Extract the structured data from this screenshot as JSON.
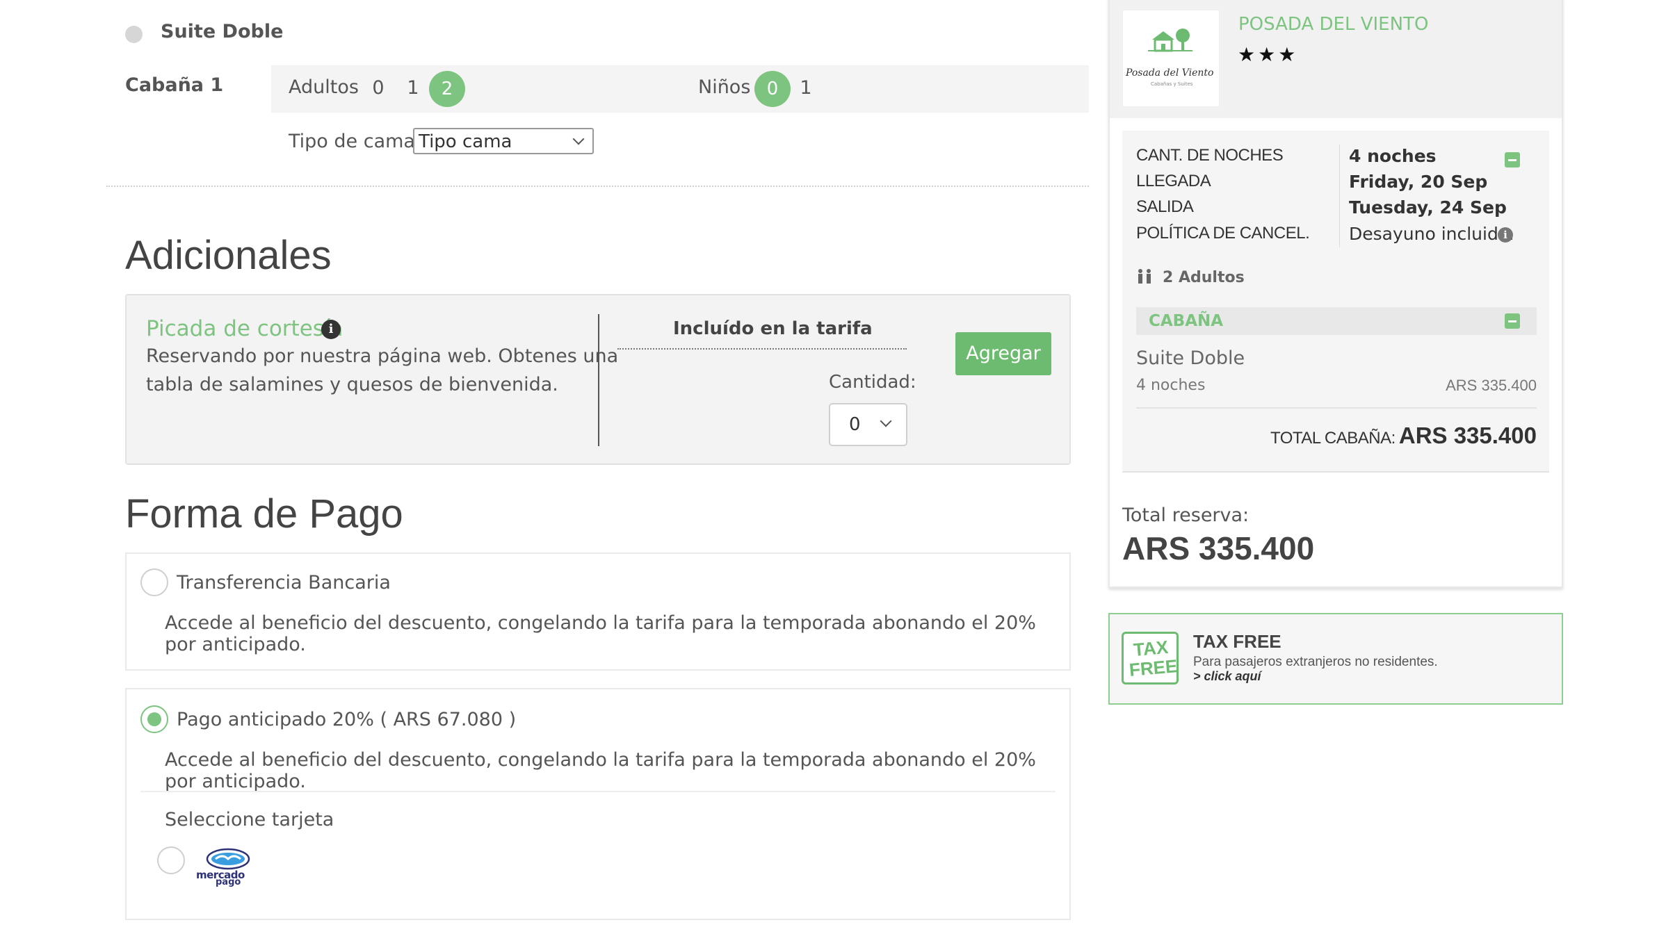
{
  "room": {
    "name": "Suite Doble",
    "cabin_label": "Cabaña 1",
    "adults_label": "Adultos",
    "adult_options": [
      "0",
      "1",
      "2"
    ],
    "adults_selected": "2",
    "children_label": "Niños",
    "children_options": [
      "0",
      "1"
    ],
    "children_selected": "0",
    "bed_label": "Tipo de cama:",
    "bed_value": "Tipo cama"
  },
  "addons": {
    "heading": "Adicionales",
    "item": {
      "title": "Picada de cortesía",
      "description_line1": "Reservando por nuestra página web. Obtenes una",
      "description_line2": "tabla de salamines y quesos de bienvenida.",
      "price_label": "Incluído en la tarifa",
      "quantity_label": "Cantidad:",
      "quantity_value": "0",
      "add_button": "Agregar"
    }
  },
  "payment": {
    "heading": "Forma de Pago",
    "options": [
      {
        "label": "Transferencia Bancaria",
        "description": "Accede al beneficio del descuento, congelando la tarifa para la temporada abonando el 20% por anticipado.",
        "selected": false
      },
      {
        "label": "Pago anticipado 20% ( ARS 67.080 )",
        "description": "Accede al beneficio del descuento, congelando la tarifa para la temporada abonando el 20% por anticipado.",
        "selected": true
      }
    ],
    "card_label": "Seleccione tarjeta",
    "card_logo_text_1": "mercado",
    "card_logo_text_2": "pago"
  },
  "sidebar": {
    "hotel_name": "POSADA DEL VIENTO",
    "logo_text": "Posada del Viento",
    "logo_subtext": "Cabañas y Suites",
    "stars": 3,
    "summary": {
      "nights_label": "CANT. DE NOCHES",
      "nights_value": "4 noches",
      "arrival_label": "LLEGADA",
      "arrival_value": "Friday, 20 Sep",
      "departure_label": "SALIDA",
      "departure_value": "Tuesday, 24 Sep",
      "policy_label": "POLÍTICA DE CANCEL.",
      "policy_value": "Desayuno incluido.",
      "guests": "2 Adultos"
    },
    "cabin_header": "CABAÑA",
    "cabin_room": "Suite Doble",
    "cabin_nights": "4 noches",
    "cabin_price": "ARS 335.400",
    "cabin_total_label": "TOTAL CABAÑA:",
    "cabin_total_value": "ARS 335.400",
    "total_label": "Total reserva:",
    "total_value": "ARS 335.400"
  },
  "taxfree": {
    "badge_line1": "TAX",
    "badge_line2": "FREE",
    "title": "TAX FREE",
    "subtitle": "Para pasajeros extranjeros no residentes.",
    "link": "> click aquí"
  },
  "colors": {
    "accent_green": "#7cc47f",
    "button_green": "#6dbb70",
    "text": "#555555"
  }
}
